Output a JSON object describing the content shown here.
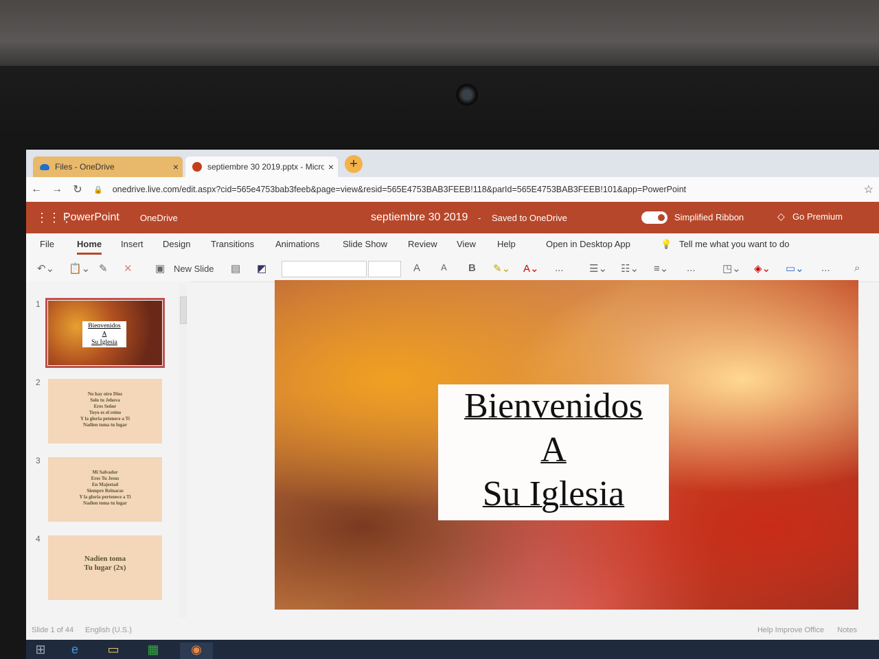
{
  "browser": {
    "tabs": [
      {
        "label": "Files - OneDrive",
        "close": "×"
      },
      {
        "label": "septiembre 30 2019.pptx - Micro",
        "close": "×"
      }
    ],
    "new_tab": "+",
    "url": "onedrive.live.com/edit.aspx?cid=565e4753bab3feeb&page=view&resid=565E4753BAB3FEEB!118&parId=565E4753BAB3FEEB!101&app=PowerPoint"
  },
  "appbar": {
    "brand": "PowerPoint",
    "location": "OneDrive",
    "doc_title": "septiembre 30 2019",
    "separator": "-",
    "save_status": "Saved to OneDrive",
    "simplified_label": "Simplified Ribbon",
    "premium_label": "Go Premium",
    "accent_color": "#b7472a"
  },
  "menu": {
    "items": [
      "File",
      "Home",
      "Insert",
      "Design",
      "Transitions",
      "Animations",
      "Slide Show",
      "Review",
      "View",
      "Help",
      "Open in Desktop App"
    ],
    "selected": "Home",
    "tell_me": "Tell me what you want to do"
  },
  "toolbar": {
    "new_slide": "New Slide",
    "bold": "B",
    "more": "..."
  },
  "thumbnails": [
    {
      "num": "1",
      "lines": [
        "Bienvenidos",
        "A",
        "Su Iglesia"
      ]
    },
    {
      "num": "2",
      "text": "No hay otro Dios\nSolo tu Jehova\nEres Señor\nTuyo es el reino\nY la gloria petenece a Ti\nNadien toma tu lugar"
    },
    {
      "num": "3",
      "text": "Mi Salvador\nEres Tu Jesus\nEn Majestad\nSiempre Reinaras\nY la gloria pertenece a Ti\nNadien toma tu lugar"
    },
    {
      "num": "4",
      "text": "Nadien toma\nTu lugar (2x)"
    }
  ],
  "slide": {
    "title_lines": [
      "Bienvenidos",
      "A",
      "Su Iglesia"
    ]
  },
  "status": {
    "slide_count": "Slide 1 of 44",
    "language": "English (U.S.)",
    "help_improve": "Help Improve Office",
    "notes": "Notes"
  }
}
